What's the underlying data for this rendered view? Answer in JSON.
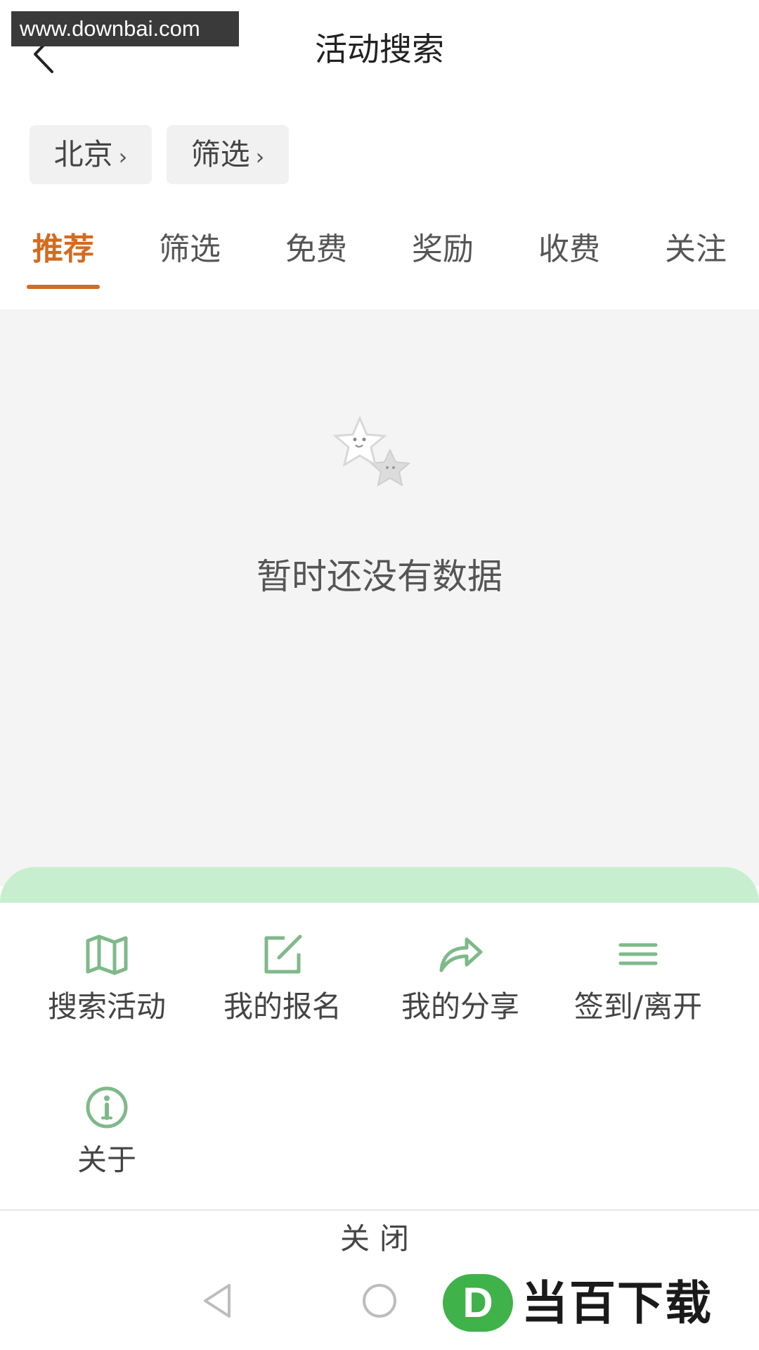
{
  "watermark": "www.downbai.com",
  "header": {
    "title": "活动搜索"
  },
  "chips": [
    {
      "label": "北京",
      "chevron": "›"
    },
    {
      "label": "筛选",
      "chevron": "›"
    }
  ],
  "tabs": [
    {
      "label": "推荐",
      "active": true
    },
    {
      "label": "筛选"
    },
    {
      "label": "免费"
    },
    {
      "label": "奖励"
    },
    {
      "label": "收费"
    },
    {
      "label": "关注"
    }
  ],
  "empty": {
    "message": "暂时还没有数据",
    "icon": "star-mascot-icon"
  },
  "menu": [
    {
      "label": "搜索活动",
      "icon": "map-icon"
    },
    {
      "label": "我的报名",
      "icon": "edit-icon"
    },
    {
      "label": "我的分享",
      "icon": "share-icon"
    },
    {
      "label": "签到/离开",
      "icon": "menu-lines-icon"
    },
    {
      "label": "关于",
      "icon": "info-icon"
    }
  ],
  "close_label": "关闭",
  "brand": {
    "letter": "D",
    "text": "当百下载"
  },
  "colors": {
    "accent": "#d36b22",
    "icon_green": "#7fb98a",
    "sheet_bar": "#c7efcf"
  }
}
